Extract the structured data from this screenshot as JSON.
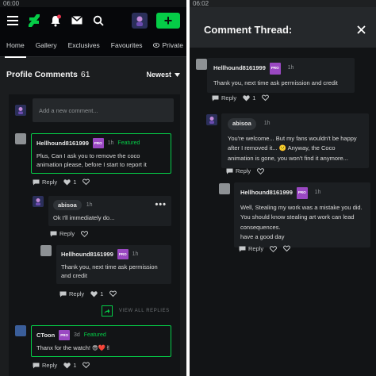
{
  "left": {
    "status_time": "06:00",
    "nav": {
      "notifications_badge": "",
      "submit_label": "+"
    },
    "tabs": [
      "Home",
      "Gallery",
      "Exclusives",
      "Favourites",
      "Private"
    ],
    "section": {
      "title": "Profile Comments",
      "count": "61",
      "sort": "Newest"
    },
    "new_comment_placeholder": "Add a new comment...",
    "comments": {
      "c1": {
        "user": "Hellhound8161999",
        "badge": "PRO",
        "time": "1h",
        "featured": "Featured",
        "text": "Plus, Can I ask you to remove the coco animation please, before I start to report it",
        "reply": "Reply",
        "likes": "1"
      },
      "c2": {
        "user": "abisoa",
        "time": "1h",
        "text": "Ok I'll immediately do...",
        "reply": "Reply"
      },
      "c3": {
        "user": "Hellhound8161999",
        "badge": "PRO",
        "time": "1h",
        "text": "Thank you, next time ask permission and credit",
        "reply": "Reply",
        "likes": "1"
      },
      "view_all": "VIEW ALL REPLIES",
      "c4": {
        "user": "CToon",
        "badge": "PRO",
        "time": "3d",
        "featured": "Featured",
        "text": "Thanx for the watch! 😎❤️✌",
        "reply": "Reply",
        "likes": "1"
      }
    }
  },
  "right": {
    "status_time": "06:02",
    "title": "Comment Thread:",
    "comments": {
      "r1": {
        "user": "Hellhound8161999",
        "badge": "PRO",
        "time": "1h",
        "text": "Thank you, next time ask permission and credit",
        "reply": "Reply",
        "likes": "1"
      },
      "r2": {
        "user": "abisoa",
        "time": "1h",
        "text": "You're welcome... But my fans wouldn't be happy after I removed it... 🙁 Anyway, the Coco animation is gone, you won't find it anymore...",
        "reply": "Reply"
      },
      "r3": {
        "user": "Hellhound8161999",
        "badge": "PRO",
        "time": "1h",
        "text": "Well, Stealing my work was a mistake you did. You should know stealing art work can lead consequences.",
        "text2": "have a good day",
        "reply": "Reply"
      }
    }
  },
  "colors": {
    "accent_green": "#05cc47",
    "pro_badge": "#9a48c2",
    "bg_dark": "#121416"
  }
}
